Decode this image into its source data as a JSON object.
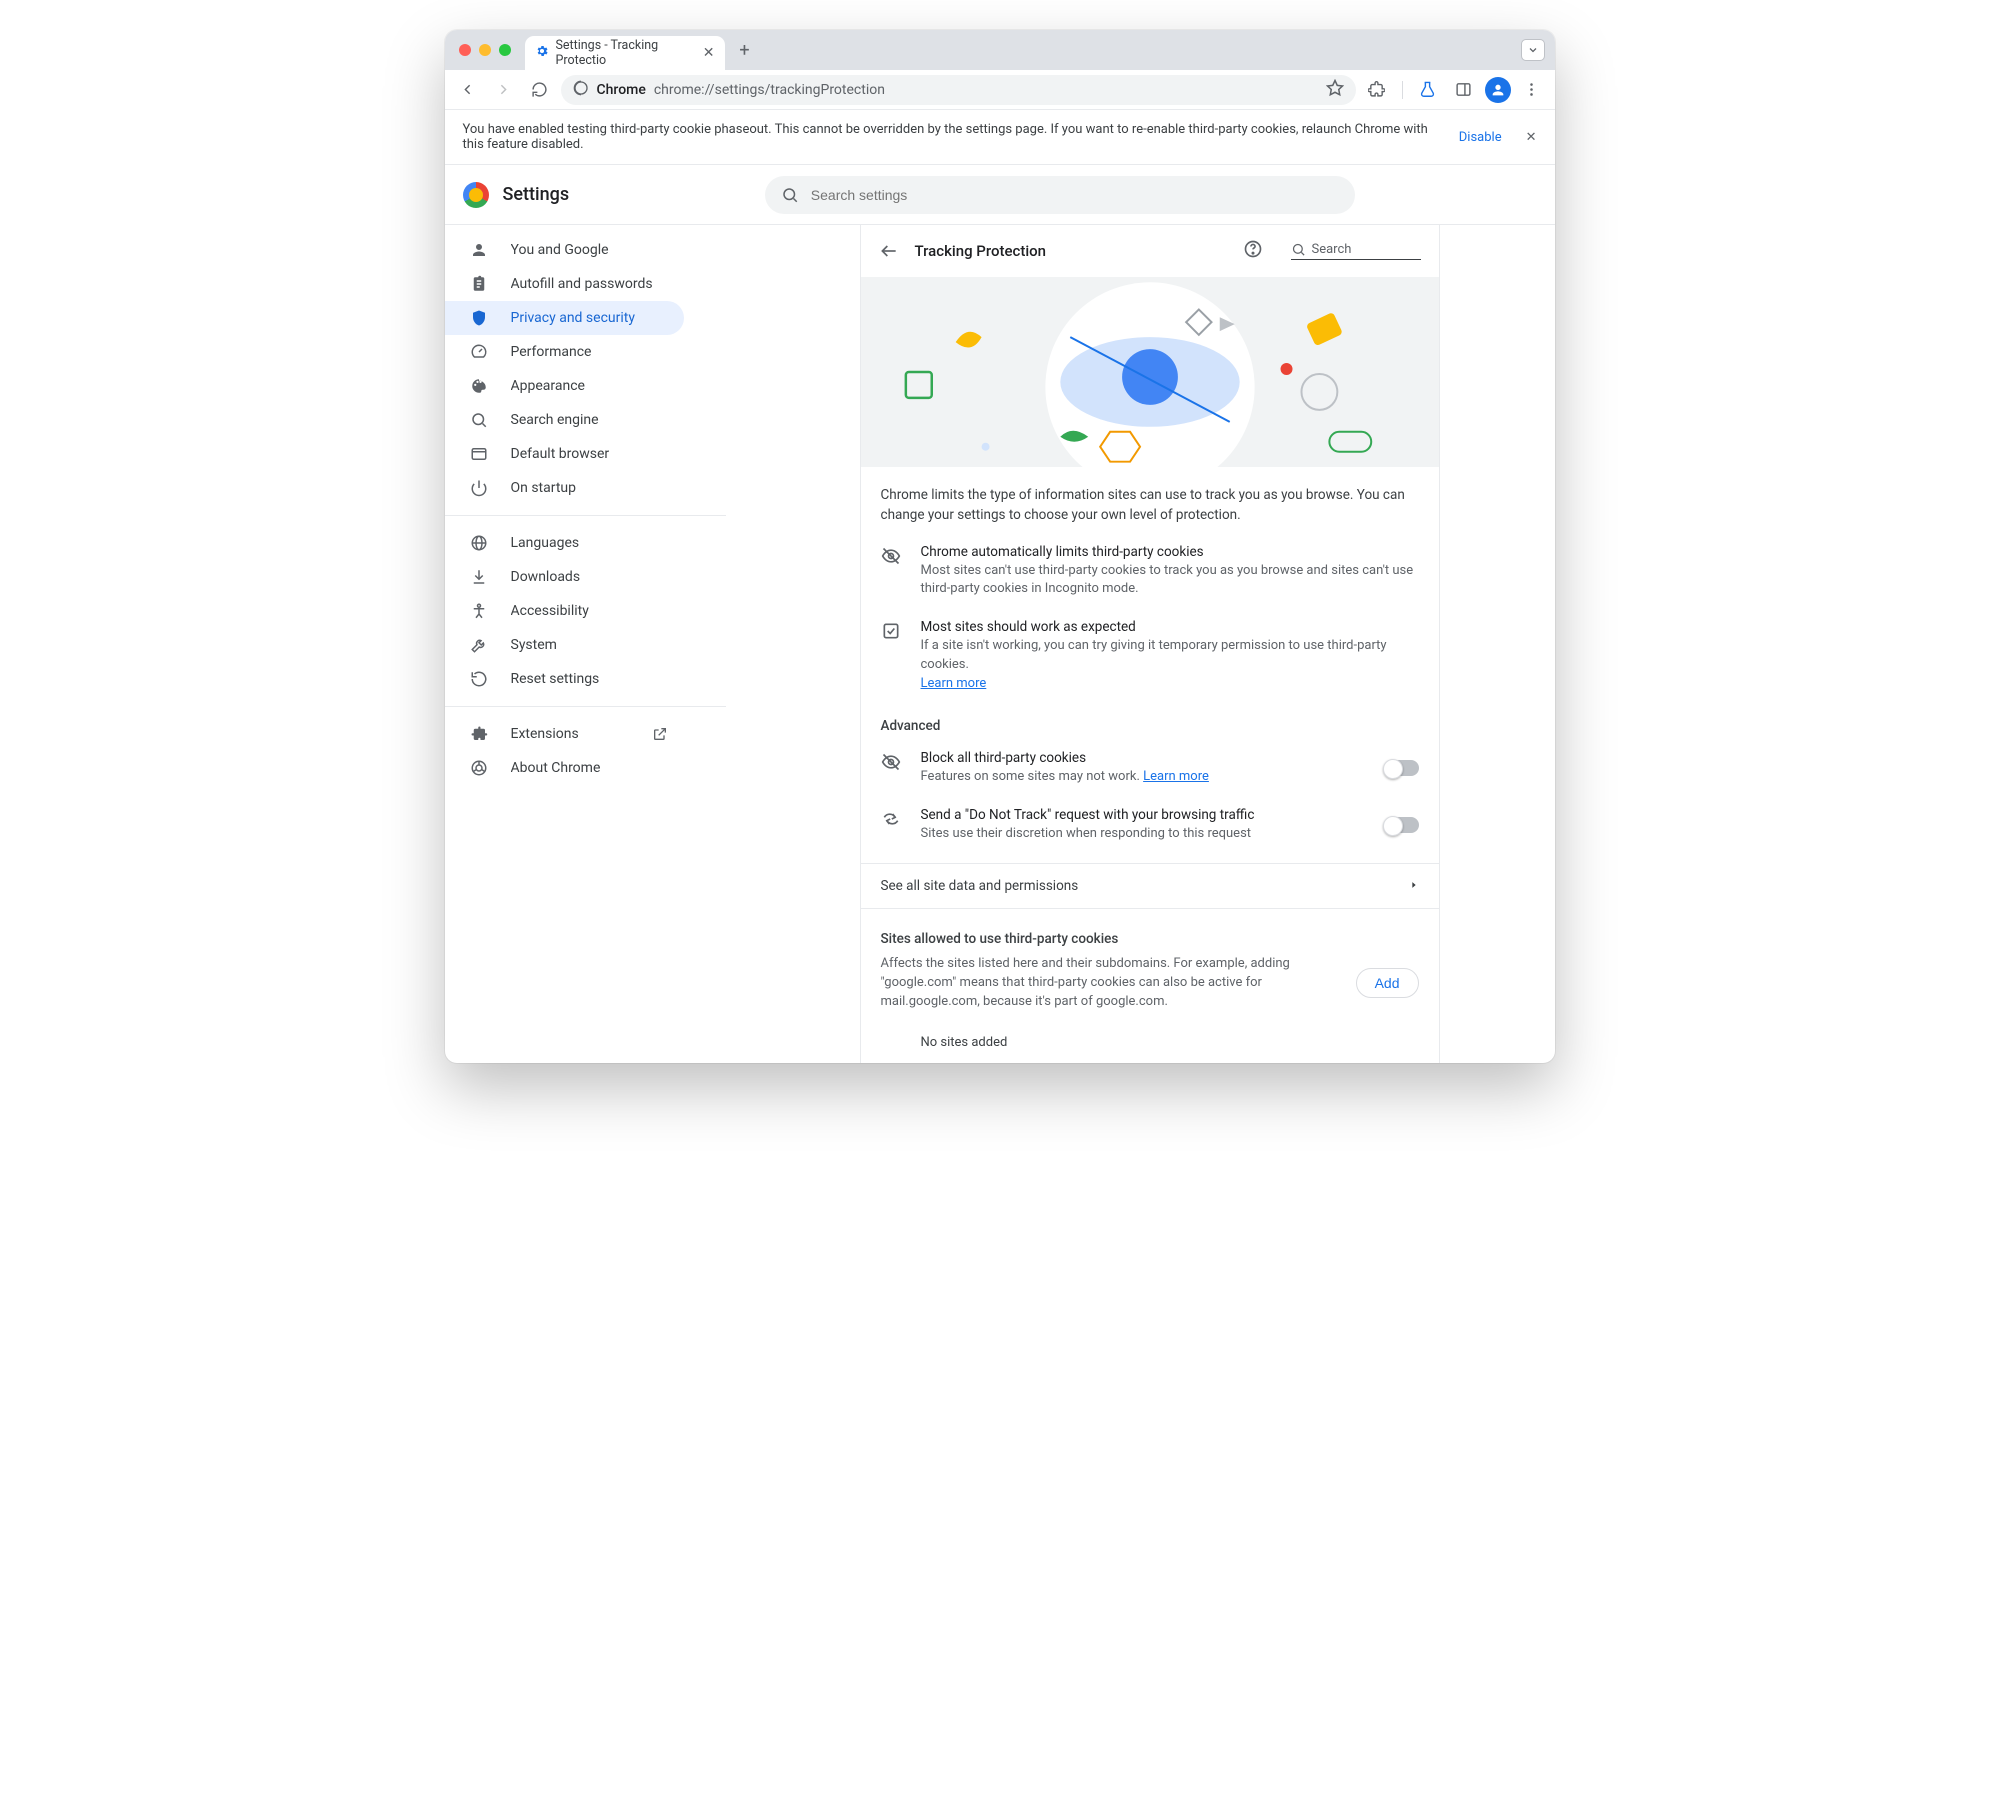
{
  "tab": {
    "title": "Settings - Tracking Protectio"
  },
  "omnibox": {
    "site": "Chrome",
    "path": "chrome://settings/trackingProtection"
  },
  "infobar": {
    "text": "You have enabled testing third-party cookie phaseout. This cannot be overridden by the settings page. If you want to re-enable third-party cookies, relaunch Chrome with this feature disabled.",
    "link": "Disable"
  },
  "header": {
    "title": "Settings",
    "search_placeholder": "Search settings"
  },
  "sidebar": {
    "items": [
      {
        "label": "You and Google"
      },
      {
        "label": "Autofill and passwords"
      },
      {
        "label": "Privacy and security"
      },
      {
        "label": "Performance"
      },
      {
        "label": "Appearance"
      },
      {
        "label": "Search engine"
      },
      {
        "label": "Default browser"
      },
      {
        "label": "On startup"
      }
    ],
    "group2": [
      {
        "label": "Languages"
      },
      {
        "label": "Downloads"
      },
      {
        "label": "Accessibility"
      },
      {
        "label": "System"
      },
      {
        "label": "Reset settings"
      }
    ],
    "group3": [
      {
        "label": "Extensions"
      },
      {
        "label": "About Chrome"
      }
    ]
  },
  "page": {
    "title": "Tracking Protection",
    "local_search": "Search",
    "intro": "Chrome limits the type of information sites can use to track you as you browse. You can change your settings to choose your own level of protection.",
    "info1": {
      "title": "Chrome automatically limits third-party cookies",
      "desc": "Most sites can't use third-party cookies to track you as you browse and sites can't use third-party cookies in Incognito mode."
    },
    "info2": {
      "title": "Most sites should work as expected",
      "desc": "If a site isn't working, you can try giving it temporary permission to use third-party cookies.",
      "link": "Learn more"
    },
    "advanced": "Advanced",
    "opt1": {
      "title": "Block all third-party cookies",
      "desc": "Features on some sites may not work.",
      "link": "Learn more"
    },
    "opt2": {
      "title": "Send a \"Do Not Track\" request with your browsing traffic",
      "desc": "Sites use their discretion when responding to this request"
    },
    "navrow": "See all site data and permissions",
    "sites": {
      "header": "Sites allowed to use third-party cookies",
      "desc": "Affects the sites listed here and their subdomains. For example, adding \"google.com\" means that third-party cookies can also be active for mail.google.com, because it's part of google.com.",
      "add": "Add",
      "empty": "No sites added"
    }
  }
}
